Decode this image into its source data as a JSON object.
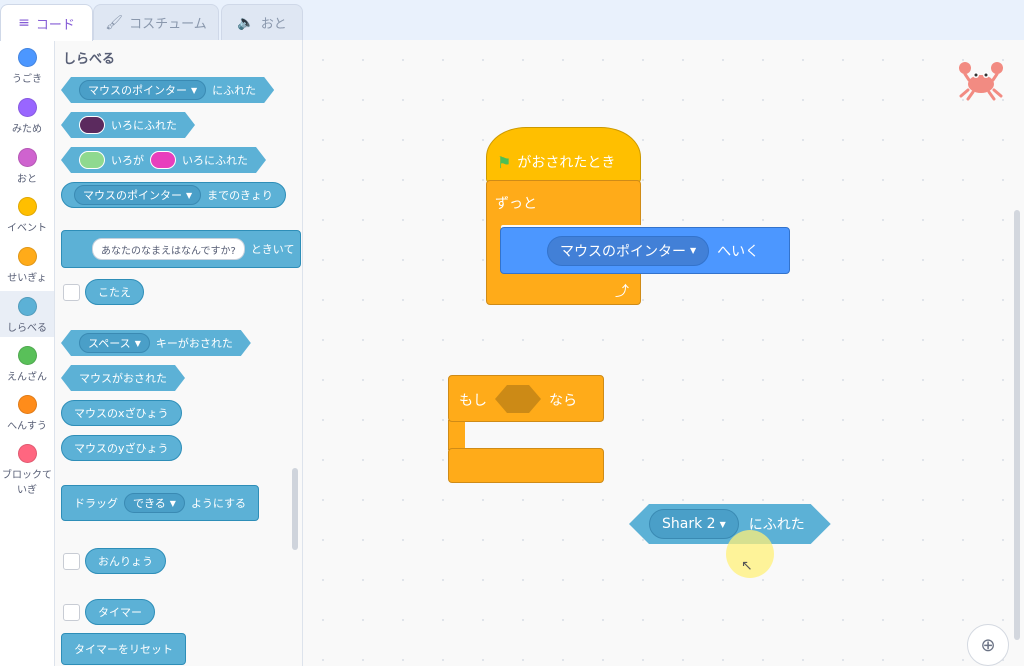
{
  "tabs": [
    {
      "label": "コード",
      "icon": "code-icon"
    },
    {
      "label": "コスチューム",
      "icon": "brush-icon"
    },
    {
      "label": "おと",
      "icon": "speaker-icon"
    }
  ],
  "categories": [
    {
      "label": "うごき",
      "color": "#4c97ff"
    },
    {
      "label": "みため",
      "color": "#9966ff"
    },
    {
      "label": "おと",
      "color": "#cf63cf"
    },
    {
      "label": "イベント",
      "color": "#ffbf00"
    },
    {
      "label": "せいぎょ",
      "color": "#ffab19"
    },
    {
      "label": "しらべる",
      "color": "#5cb1d6"
    },
    {
      "label": "えんざん",
      "color": "#59c059"
    },
    {
      "label": "へんすう",
      "color": "#ff8c1a"
    },
    {
      "label": "ブロックて",
      "label2": "いぎ",
      "color": "#ff6680"
    }
  ],
  "palette": {
    "title": "しらべる",
    "touching_pointer": {
      "dropdown": "マウスのポインター",
      "text": "にふれた"
    },
    "touching_color": {
      "text": "いろにふれた",
      "color": "#5b2a5e"
    },
    "color_touching": {
      "text1": "いろが",
      "text2": "いろにふれた",
      "color1": "#8fd98f",
      "color2": "#e83fbd"
    },
    "distance_to": {
      "dropdown": "マウスのポインター",
      "text": "までのきょり"
    },
    "ask": {
      "input": "あなたのなまえはなんですか?",
      "text": "ときいて"
    },
    "answer": "こたえ",
    "key_pressed": {
      "dropdown": "スペース",
      "text": "キーがおされた"
    },
    "mouse_down": "マウスがおされた",
    "mouse_x": "マウスのxざひょう",
    "mouse_y": "マウスのyざひょう",
    "drag_mode": {
      "text1": "ドラッグ",
      "dropdown": "できる",
      "text2": "ようにする"
    },
    "loudness": "おんりょう",
    "timer": "タイマー",
    "reset_timer": "タイマーをリセット"
  },
  "workspace": {
    "when_flag": "がおされたとき",
    "forever": "ずっと",
    "point_towards": {
      "dropdown": "マウスのポインター",
      "text": "へいく"
    },
    "if_then": {
      "if": "もし",
      "then": "なら"
    },
    "touching": {
      "dropdown": "Shark 2",
      "text": "にふれた"
    }
  }
}
